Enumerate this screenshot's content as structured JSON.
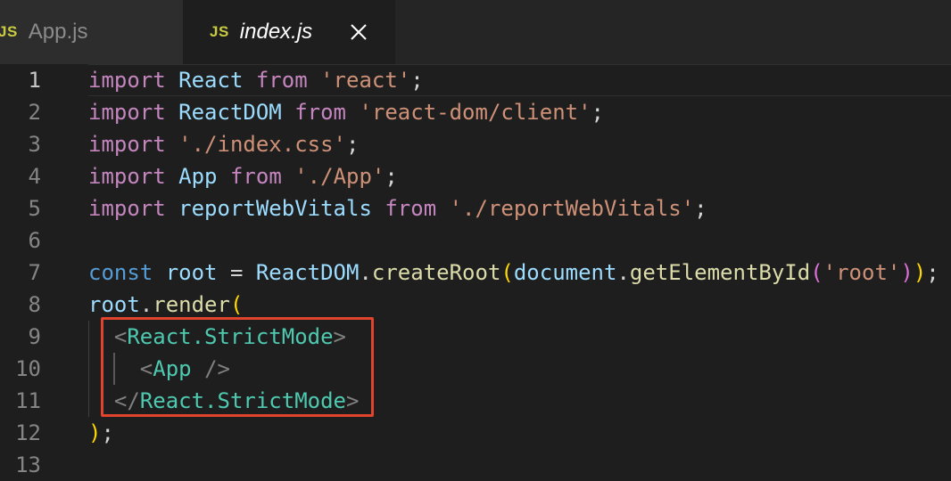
{
  "tabs": [
    {
      "icon": "JS",
      "label": "App.js",
      "active": false
    },
    {
      "icon": "JS",
      "label": "index.js",
      "active": true
    }
  ],
  "editor": {
    "lines": [
      {
        "number": "1",
        "tokens": [
          [
            "kw",
            "import"
          ],
          [
            "pun",
            " "
          ],
          [
            "var",
            "React"
          ],
          [
            "pun",
            " "
          ],
          [
            "kw",
            "from"
          ],
          [
            "pun",
            " "
          ],
          [
            "str",
            "'react'"
          ],
          [
            "pun",
            ";"
          ]
        ]
      },
      {
        "number": "2",
        "tokens": [
          [
            "kw",
            "import"
          ],
          [
            "pun",
            " "
          ],
          [
            "var",
            "ReactDOM"
          ],
          [
            "pun",
            " "
          ],
          [
            "kw",
            "from"
          ],
          [
            "pun",
            " "
          ],
          [
            "str",
            "'react-dom/client'"
          ],
          [
            "pun",
            ";"
          ]
        ]
      },
      {
        "number": "3",
        "tokens": [
          [
            "kw",
            "import"
          ],
          [
            "pun",
            " "
          ],
          [
            "str",
            "'./index.css'"
          ],
          [
            "pun",
            ";"
          ]
        ]
      },
      {
        "number": "4",
        "tokens": [
          [
            "kw",
            "import"
          ],
          [
            "pun",
            " "
          ],
          [
            "var",
            "App"
          ],
          [
            "pun",
            " "
          ],
          [
            "kw",
            "from"
          ],
          [
            "pun",
            " "
          ],
          [
            "str",
            "'./App'"
          ],
          [
            "pun",
            ";"
          ]
        ]
      },
      {
        "number": "5",
        "tokens": [
          [
            "kw",
            "import"
          ],
          [
            "pun",
            " "
          ],
          [
            "var",
            "reportWebVitals"
          ],
          [
            "pun",
            " "
          ],
          [
            "kw",
            "from"
          ],
          [
            "pun",
            " "
          ],
          [
            "str",
            "'./reportWebVitals'"
          ],
          [
            "pun",
            ";"
          ]
        ]
      },
      {
        "number": "6",
        "tokens": []
      },
      {
        "number": "7",
        "tokens": [
          [
            "kwb",
            "const"
          ],
          [
            "pun",
            " "
          ],
          [
            "var",
            "root"
          ],
          [
            "pun",
            " = "
          ],
          [
            "var",
            "ReactDOM"
          ],
          [
            "pun",
            "."
          ],
          [
            "fn",
            "createRoot"
          ],
          [
            "br1",
            "("
          ],
          [
            "var",
            "document"
          ],
          [
            "pun",
            "."
          ],
          [
            "fn",
            "getElementById"
          ],
          [
            "br2",
            "("
          ],
          [
            "str",
            "'root'"
          ],
          [
            "br2",
            ")"
          ],
          [
            "br1",
            ")"
          ],
          [
            "pun",
            ";"
          ]
        ]
      },
      {
        "number": "8",
        "tokens": [
          [
            "var",
            "root"
          ],
          [
            "pun",
            "."
          ],
          [
            "fn",
            "render"
          ],
          [
            "br1",
            "("
          ]
        ]
      },
      {
        "number": "9",
        "tokens": [
          [
            "pun",
            "  "
          ],
          [
            "tag",
            "<"
          ],
          [
            "jsx",
            "React.StrictMode"
          ],
          [
            "tag",
            ">"
          ]
        ]
      },
      {
        "number": "10",
        "tokens": [
          [
            "pun",
            "    "
          ],
          [
            "tag",
            "<"
          ],
          [
            "jsx",
            "App"
          ],
          [
            "pun",
            " "
          ],
          [
            "tag",
            "/>"
          ]
        ]
      },
      {
        "number": "11",
        "tokens": [
          [
            "pun",
            "  "
          ],
          [
            "tag",
            "</"
          ],
          [
            "jsx",
            "React.StrictMode"
          ],
          [
            "tag",
            ">"
          ]
        ]
      },
      {
        "number": "12",
        "tokens": [
          [
            "br1",
            ")"
          ],
          [
            "pun",
            ";"
          ]
        ]
      },
      {
        "number": "13",
        "tokens": []
      }
    ]
  },
  "colors": {
    "highlight_box": "#e0442c",
    "js_icon": "#cbcb41"
  }
}
